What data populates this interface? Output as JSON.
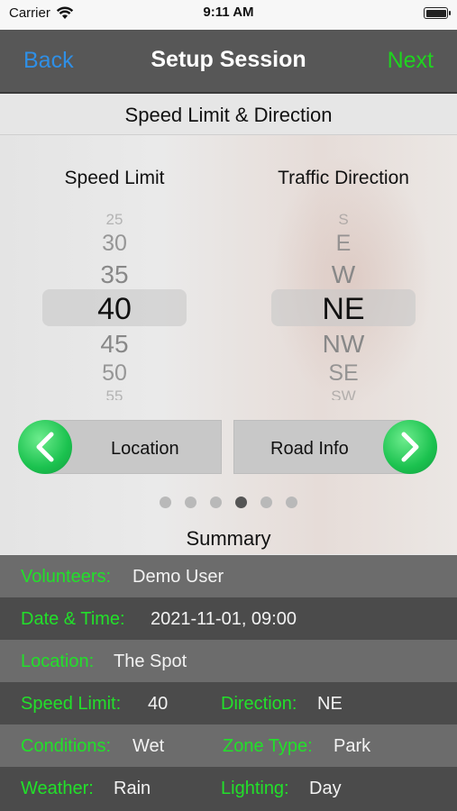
{
  "status_bar": {
    "carrier": "Carrier",
    "time": "9:11 AM"
  },
  "nav": {
    "back": "Back",
    "title": "Setup Session",
    "next": "Next"
  },
  "section_header": "Speed Limit & Direction",
  "speed_picker": {
    "label": "Speed Limit",
    "items": [
      "25",
      "30",
      "35",
      "40",
      "45",
      "50",
      "55"
    ],
    "selected": "40"
  },
  "direction_picker": {
    "label": "Traffic Direction",
    "items": [
      "S",
      "E",
      "W",
      "NE",
      "NW",
      "SE",
      "SW"
    ],
    "selected": "NE"
  },
  "buttons": {
    "prev": "Location",
    "next": "Road Info"
  },
  "page_indicator": {
    "count": 6,
    "active_index": 3
  },
  "summary": {
    "title": "Summary",
    "volunteers_label": "Volunteers:",
    "volunteers_value": "Demo User",
    "datetime_label": "Date & Time:",
    "datetime_value": "2021-11-01, 09:00",
    "location_label": "Location:",
    "location_value": "The Spot",
    "speed_label": "Speed Limit:",
    "speed_value": "40",
    "direction_label": "Direction:",
    "direction_value": "NE",
    "conditions_label": "Conditions:",
    "conditions_value": "Wet",
    "zone_label": "Zone Type:",
    "zone_value": "Park",
    "weather_label": "Weather:",
    "weather_value": "Rain",
    "lighting_label": "Lighting:",
    "lighting_value": "Day"
  },
  "colors": {
    "accent_green": "#22e02a",
    "back_blue": "#2f8fe6",
    "nav_bg": "#575757"
  }
}
